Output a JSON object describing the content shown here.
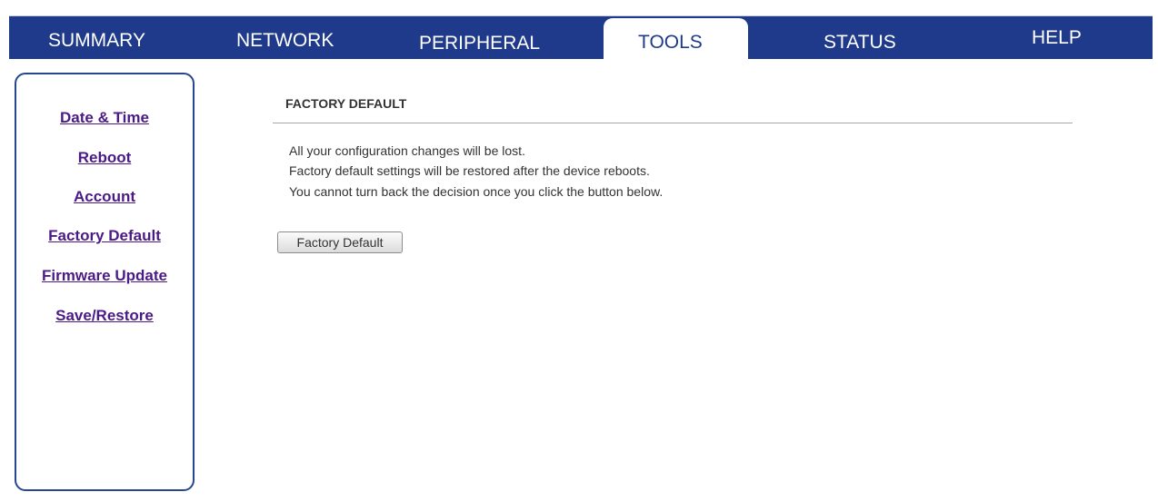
{
  "nav": {
    "tabs": [
      {
        "label": "SUMMARY",
        "active": false
      },
      {
        "label": "NETWORK",
        "active": false
      },
      {
        "label": "PERIPHERAL",
        "active": false
      },
      {
        "label": "TOOLS",
        "active": true
      },
      {
        "label": "STATUS",
        "active": false
      },
      {
        "label": "HELP",
        "active": false
      }
    ]
  },
  "sidebar": {
    "items": [
      {
        "label": "Date & Time"
      },
      {
        "label": "Reboot"
      },
      {
        "label": "Account"
      },
      {
        "label": "Factory Default"
      },
      {
        "label": "Firmware Update"
      },
      {
        "label": "Save/Restore"
      }
    ]
  },
  "main": {
    "title": "FACTORY DEFAULT",
    "messages": [
      "All your configuration changes will be lost.",
      "Factory default settings will be restored after the device reboots.",
      "You cannot turn back the decision once you click the button below."
    ],
    "button_label": "Factory Default"
  },
  "colors": {
    "nav_bar": "#1f3a8a",
    "sidebar_border": "#27468f",
    "link": "#4b1a86"
  }
}
